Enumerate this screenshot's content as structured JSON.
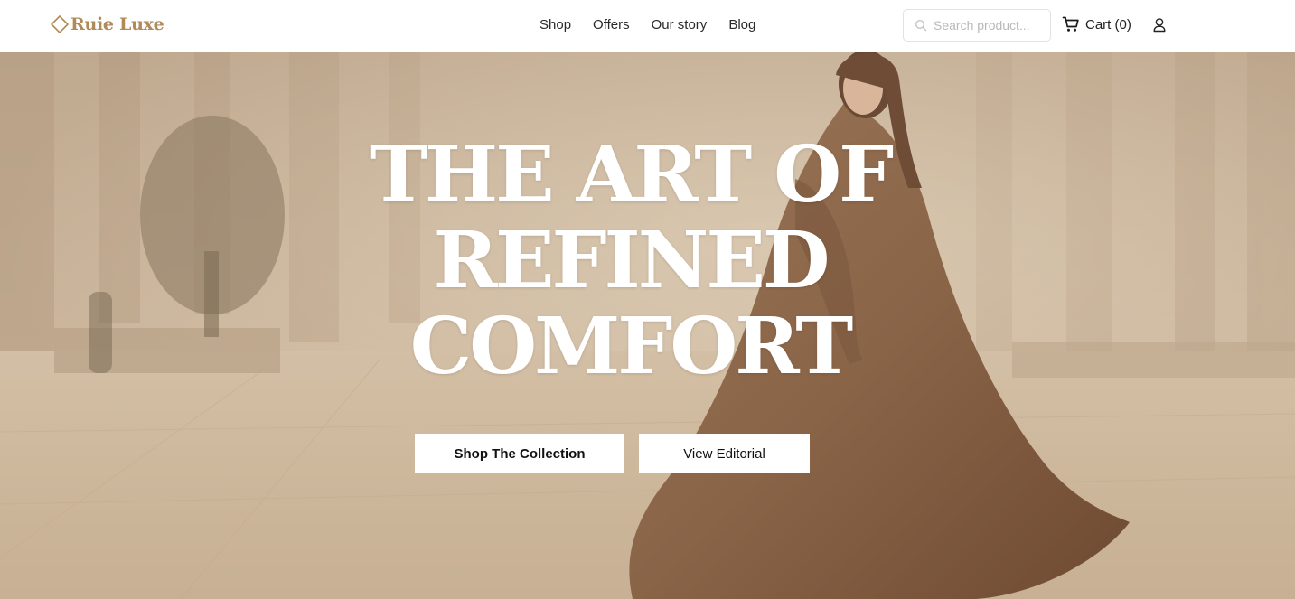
{
  "brand": {
    "name": "Ruie Luxe",
    "color": "#b08a57",
    "icon": "diamond-outline-icon"
  },
  "nav": {
    "items": [
      {
        "label": "Shop"
      },
      {
        "label": "Offers"
      },
      {
        "label": "Our story"
      },
      {
        "label": "Blog"
      }
    ]
  },
  "search": {
    "placeholder": "Search product...",
    "value": "",
    "icon": "search-icon"
  },
  "cart": {
    "label": "Cart (0)",
    "icon": "cart-icon"
  },
  "account": {
    "icon": "user-icon"
  },
  "hero": {
    "title_lines": [
      "THE ART OF",
      "REFINED",
      "COMFORT"
    ],
    "primary_button": "Shop The Collection",
    "secondary_button": "View Editorial"
  }
}
